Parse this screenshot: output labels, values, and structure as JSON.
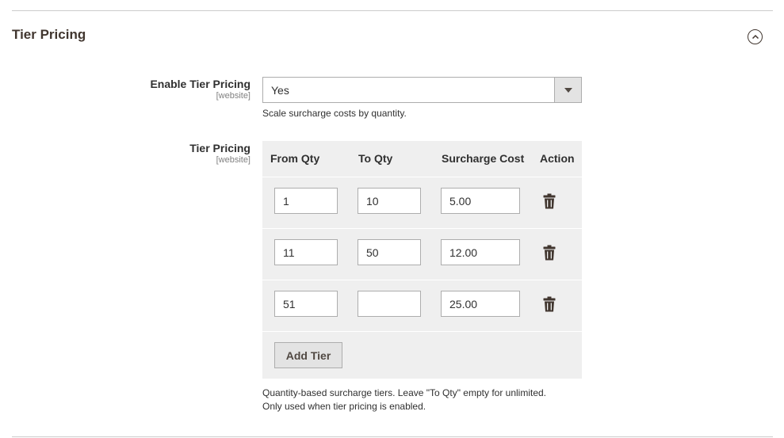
{
  "section": {
    "title": "Tier Pricing",
    "collapse_icon": "chevron-up-circle-icon"
  },
  "enable_tier_pricing": {
    "label": "Enable Tier Pricing",
    "scope": "[website]",
    "selected": "Yes",
    "note": "Scale surcharge costs by quantity."
  },
  "tier_pricing": {
    "label": "Tier Pricing",
    "scope": "[website]",
    "columns": [
      "From Qty",
      "To Qty",
      "Surcharge Cost",
      "Action"
    ],
    "rows": [
      {
        "from_qty": "1",
        "to_qty": "10",
        "surcharge_cost": "5.00"
      },
      {
        "from_qty": "11",
        "to_qty": "50",
        "surcharge_cost": "12.00"
      },
      {
        "from_qty": "51",
        "to_qty": "",
        "surcharge_cost": "25.00"
      }
    ],
    "delete_icon": "trash-icon",
    "add_button": "Add Tier",
    "note_line1": "Quantity-based surcharge tiers. Leave \"To Qty\" empty for unlimited.",
    "note_line2": "Only used when tier pricing is enabled."
  }
}
